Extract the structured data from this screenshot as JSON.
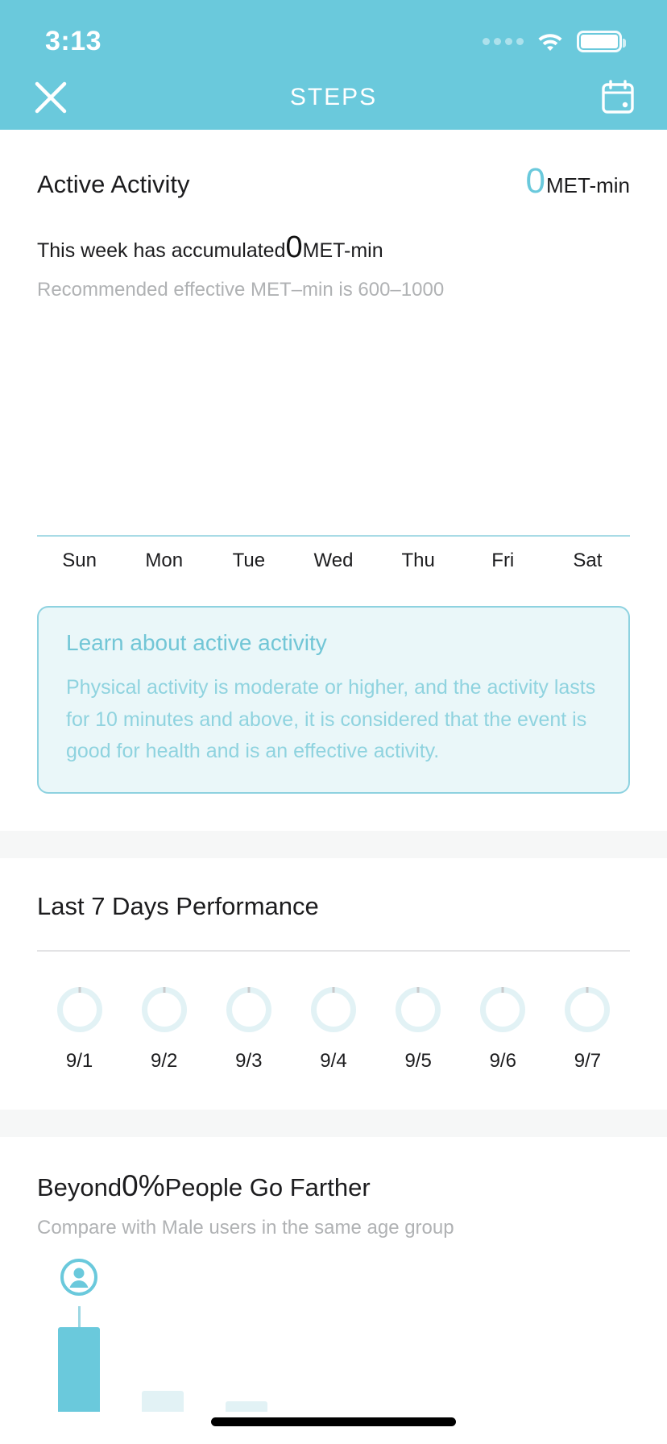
{
  "status_bar": {
    "time": "3:13",
    "signal_icon": "signal-dots-icon",
    "wifi_icon": "wifi-icon",
    "battery_icon": "battery-full-icon"
  },
  "nav": {
    "close_label": "close-icon",
    "title": "STEPS",
    "calendar_label": "calendar-icon"
  },
  "active_activity": {
    "title": "Active Activity",
    "met_value": "0",
    "met_unit": "MET-min",
    "accumulated_prefix": "This week has accumulated",
    "accumulated_value": "0",
    "accumulated_unit": "MET-min",
    "recommendation": "Recommended effective MET–min is 600–1000"
  },
  "info_card": {
    "title": "Learn about active activity",
    "body": "Physical activity is moderate or higher, and the activity lasts for 10 minutes and above, it is considered that the event is good for health and is an effective activity."
  },
  "last_7_days": {
    "title": "Last 7 Days Performance",
    "days": [
      {
        "date": "9/1",
        "progress": 0
      },
      {
        "date": "9/2",
        "progress": 0
      },
      {
        "date": "9/3",
        "progress": 0
      },
      {
        "date": "9/4",
        "progress": 0
      },
      {
        "date": "9/5",
        "progress": 0
      },
      {
        "date": "9/6",
        "progress": 0
      },
      {
        "date": "9/7",
        "progress": 0
      }
    ]
  },
  "comparison": {
    "title_prefix": "Beyond",
    "percent": "0%",
    "title_suffix": "People Go Farther",
    "subtitle": "Compare with Male users in the same age group",
    "avatar_icon": "person-avatar-icon"
  },
  "colors": {
    "brand_teal": "#6ac9dc",
    "light_teal": "#e2f2f5",
    "card_bg": "#eaf7f9",
    "card_border": "#8ed2e0",
    "muted_text": "#b0b2b4",
    "primary_text": "#1c1c1e"
  },
  "chart_data": [
    {
      "type": "bar",
      "title": "Active Activity (MET-min) by day of week",
      "categories": [
        "Sun",
        "Mon",
        "Tue",
        "Wed",
        "Thu",
        "Fri",
        "Sat"
      ],
      "values": [
        0,
        0,
        0,
        0,
        0,
        0,
        0
      ],
      "xlabel": "",
      "ylabel": "MET-min",
      "ylim": [
        0,
        1000
      ],
      "grid": false,
      "legend": "none"
    },
    {
      "type": "bar",
      "title": "Beyond 0% People Go Farther",
      "categories": [
        "You",
        "",
        "",
        "",
        "",
        "",
        ""
      ],
      "values": [
        100,
        24,
        12,
        0,
        0,
        0,
        0
      ],
      "xlabel": "",
      "ylabel": "",
      "ylim": [
        0,
        100
      ],
      "grid": false,
      "legend": "none",
      "highlight_index": 0
    }
  ]
}
